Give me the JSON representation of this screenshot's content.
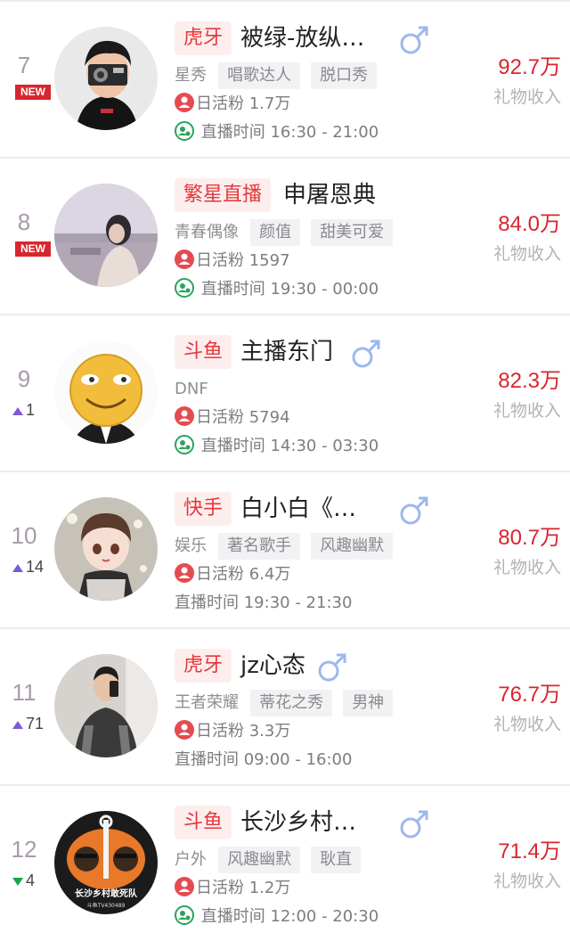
{
  "income_label": "礼物收入",
  "dau_label": "日活粉",
  "live_label": "直播时间",
  "accent": "#d8262e",
  "rows": [
    {
      "rank": "7",
      "badge": "NEW",
      "trend": null,
      "platform": "虎牙",
      "name": "被绿-放纵…",
      "gender": "male",
      "category": "星秀",
      "tags": [
        "唱歌达人",
        "脱口秀"
      ],
      "dau": "1.7万",
      "live_time": "16:30 - 21:00",
      "income": "92.7万"
    },
    {
      "rank": "8",
      "badge": "NEW",
      "trend": null,
      "platform": "繁星直播",
      "name": "申屠恩典",
      "gender": null,
      "category": "青春偶像",
      "tags": [
        "颜值",
        "甜美可爱"
      ],
      "dau": "1597",
      "live_time": "19:30 - 00:00",
      "income": "84.0万"
    },
    {
      "rank": "9",
      "badge": null,
      "trend": {
        "dir": "up",
        "value": "1"
      },
      "platform": "斗鱼",
      "name": "主播东门",
      "gender": "male",
      "category": "DNF",
      "tags": [],
      "dau": "5794",
      "live_time": "14:30 - 03:30",
      "income": "82.3万"
    },
    {
      "rank": "10",
      "badge": null,
      "trend": {
        "dir": "up",
        "value": "14"
      },
      "platform": "快手",
      "name": "白小白《…",
      "gender": "male",
      "category": "娱乐",
      "tags": [
        "著名歌手",
        "风趣幽默"
      ],
      "dau": "6.4万",
      "live_time": "19:30 - 21:30",
      "income": "80.7万"
    },
    {
      "rank": "11",
      "badge": null,
      "trend": {
        "dir": "up",
        "value": "71"
      },
      "platform": "虎牙",
      "name": "jz心态",
      "gender": "male",
      "category": "王者荣耀",
      "tags": [
        "蒂花之秀",
        "男神"
      ],
      "dau": "3.3万",
      "live_time": "09:00 - 16:00",
      "income": "76.7万"
    },
    {
      "rank": "12",
      "badge": null,
      "trend": {
        "dir": "down",
        "value": "4"
      },
      "platform": "斗鱼",
      "name": "长沙乡村…",
      "gender": "male",
      "category": "户外",
      "tags": [
        "风趣幽默",
        "耿直"
      ],
      "dau": "1.2万",
      "live_time": "12:00 - 20:30",
      "income": "71.4万",
      "avatar_text": [
        "长沙乡村敢死队",
        "斗鱼TV430489"
      ]
    }
  ]
}
